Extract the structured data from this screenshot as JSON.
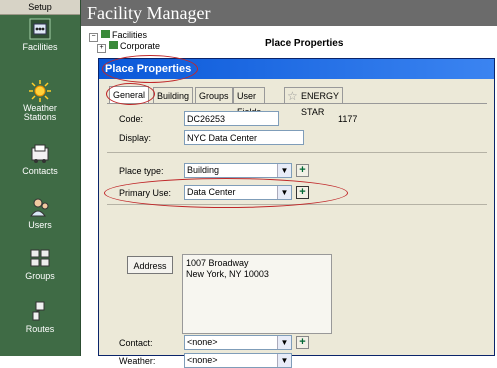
{
  "nav": {
    "header": "Setup",
    "items": [
      {
        "label": "Facilities"
      },
      {
        "label": "Weather\nStations"
      },
      {
        "label": "Contacts"
      },
      {
        "label": "Users"
      },
      {
        "label": "Groups"
      },
      {
        "label": "Routes"
      }
    ]
  },
  "app": {
    "title": "Facility Manager"
  },
  "tree": {
    "root": "Facilities",
    "child": "Corporate"
  },
  "panel_heading": "Place Properties",
  "dialog": {
    "title": "Place Properties",
    "tabs": [
      "General",
      "Building",
      "Groups",
      "User Fields",
      "ENERGY STAR"
    ],
    "code_label": "Code:",
    "code_value": "DC26253",
    "code_id": "1177",
    "display_label": "Display:",
    "display_value": "NYC Data Center",
    "place_type_label": "Place type:",
    "place_type_value": "Building",
    "primary_use_label": "Primary Use:",
    "primary_use_value": "Data Center",
    "address_button": "Address",
    "address_text": "1007 Broadway\nNew York, NY 10003",
    "contact_label": "Contact:",
    "contact_value": "<none>",
    "weather_label": "Weather:",
    "weather_value": "<none>"
  },
  "colors": {
    "nav_bg": "#3f6b45",
    "titlebar": "#0a58d8",
    "highlight": "#c0282a"
  }
}
